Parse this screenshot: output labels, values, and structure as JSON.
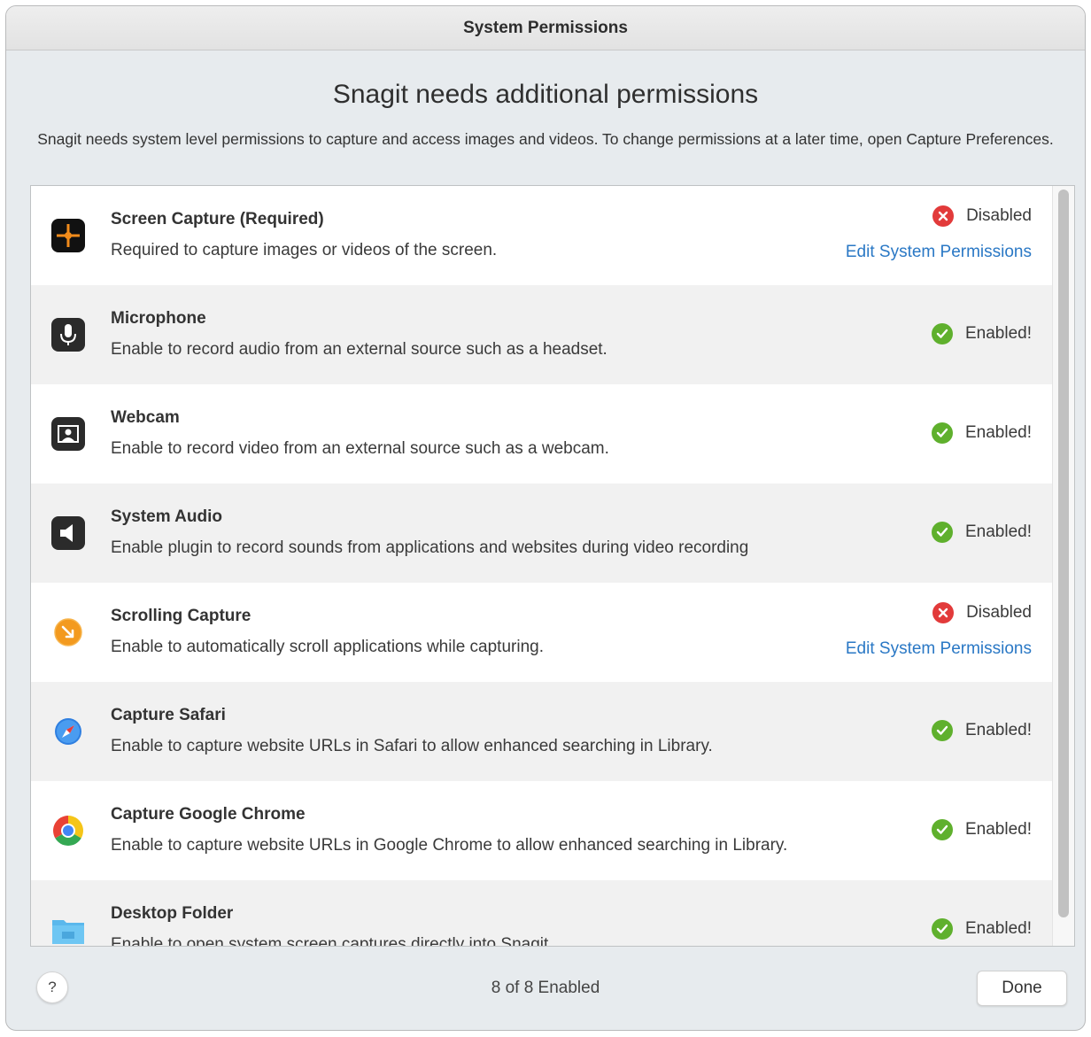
{
  "window": {
    "title": "System Permissions"
  },
  "header": {
    "heading": "Snagit needs additional permissions",
    "intro": "Snagit needs system level permissions to capture and access images and videos. To change permissions at a later time, open Capture Preferences."
  },
  "permissions": [
    {
      "icon": "screen-capture-icon",
      "title": "Screen Capture (Required)",
      "description": "Required to capture images or videos of the screen.",
      "status": "Disabled",
      "link": "Edit System Permissions"
    },
    {
      "icon": "microphone-icon",
      "title": "Microphone",
      "description": "Enable to record audio from an external source such as a headset.",
      "status": "Enabled!"
    },
    {
      "icon": "webcam-icon",
      "title": "Webcam",
      "description": "Enable to record video from an external source such as a webcam.",
      "status": "Enabled!"
    },
    {
      "icon": "speaker-icon",
      "title": "System Audio",
      "description": "Enable plugin to record sounds from applications and websites during video recording",
      "status": "Enabled!"
    },
    {
      "icon": "scrolling-capture-icon",
      "title": "Scrolling Capture",
      "description": "Enable to automatically scroll applications while capturing.",
      "status": "Disabled",
      "link": "Edit System Permissions"
    },
    {
      "icon": "safari-icon",
      "title": "Capture Safari",
      "description": "Enable to capture website URLs in Safari to allow enhanced searching in Library.",
      "status": "Enabled!"
    },
    {
      "icon": "chrome-icon",
      "title": "Capture Google Chrome",
      "description": "Enable to capture website URLs in Google Chrome to allow enhanced searching in Library.",
      "status": "Enabled!"
    },
    {
      "icon": "folder-icon",
      "title": "Desktop Folder",
      "description": "Enable to open system screen captures directly into Snagit.",
      "status": "Enabled!"
    }
  ],
  "footer": {
    "help_label": "?",
    "count_text": "8 of 8 Enabled",
    "done_label": "Done"
  },
  "colors": {
    "enabled": "#5fb02d",
    "disabled": "#e23a3a",
    "link": "#2a78c5"
  }
}
